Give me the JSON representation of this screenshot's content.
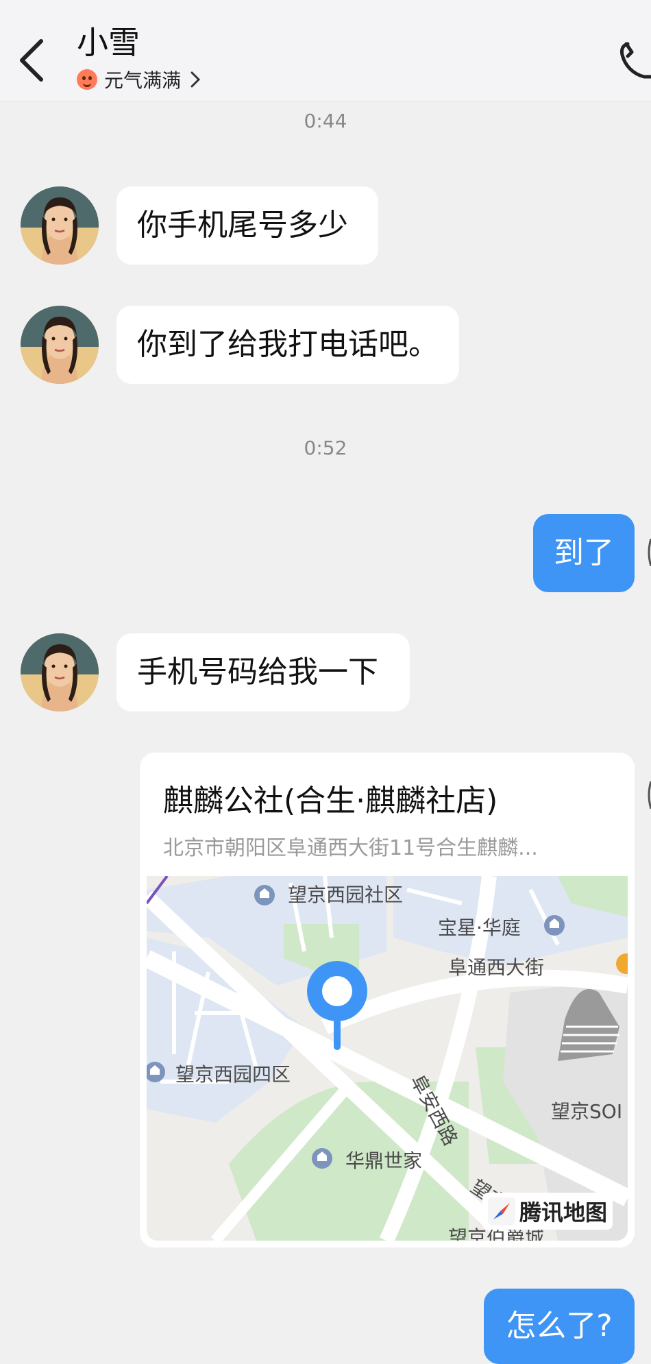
{
  "header": {
    "title": "小雪",
    "status_text": "元气满满"
  },
  "messages": {
    "time_1": "0:44",
    "msg_1": "你手机尾号多少",
    "msg_2": "你到了给我打电话吧。",
    "time_2": "0:52",
    "msg_3_out": "到了",
    "msg_4": "手机号码给我一下",
    "msg_6_out": "怎么了?"
  },
  "location": {
    "name": "麒麟公社(合生·麒麟社店)",
    "address": "北京市朝阳区阜通西大街11号合生麒麟...",
    "labels": {
      "poi_1": "望京西园社区",
      "poi_2": "宝星·华庭",
      "street_1": "阜通西大街",
      "poi_3": "望京西园四区",
      "road_1": "阜安西路",
      "poi_4": "望京SOI",
      "poi_5": "华鼎世家",
      "road_2": "望京街",
      "poi_6": "望京伯爵城"
    },
    "map_logo": "腾讯地图"
  },
  "colors": {
    "accent": "#3f95f5",
    "background": "#f0f0f0",
    "bubble_in": "#ffffff"
  },
  "icons": {
    "back": "chevron-left-icon",
    "status": "smiling-face-icon",
    "chevron": "chevron-right-icon",
    "phone": "phone-icon",
    "pin": "map-pin-icon",
    "compass": "compass-icon"
  }
}
